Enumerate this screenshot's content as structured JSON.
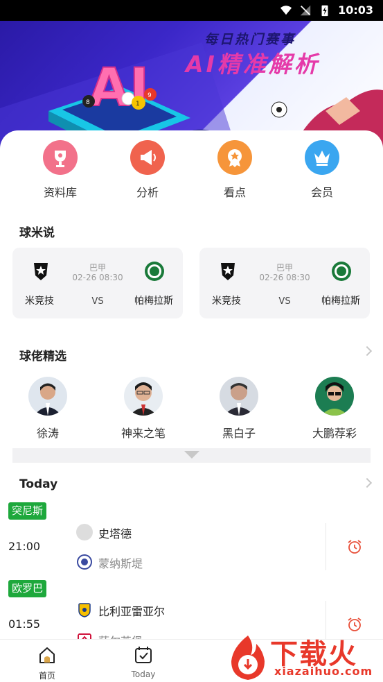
{
  "status_bar": {
    "time": "10:03"
  },
  "banner": {
    "line1": "每日热门赛事",
    "line2": "AI精准解析",
    "logo_text": "AI"
  },
  "quick_menu": [
    {
      "label": "资料库",
      "icon": "trophy-icon",
      "color": "#f2718a"
    },
    {
      "label": "分析",
      "icon": "megaphone-icon",
      "color": "#f0634e"
    },
    {
      "label": "看点",
      "icon": "medal-icon",
      "color": "#f6953a"
    },
    {
      "label": "会员",
      "icon": "crown-icon",
      "color": "#3aa6f0"
    }
  ],
  "section_qiumi": {
    "title": "球米说"
  },
  "match_cards": [
    {
      "home": "米竞技",
      "away": "帕梅拉斯",
      "league": "巴甲",
      "datetime": "02-26 08:30",
      "vs": "VS"
    },
    {
      "home": "米竞技",
      "away": "帕梅拉斯",
      "league": "巴甲",
      "datetime": "02-26 08:30",
      "vs": "VS"
    }
  ],
  "section_experts": {
    "title": "球佬精选"
  },
  "experts": [
    {
      "name": "徐涛"
    },
    {
      "name": "神来之笔"
    },
    {
      "name": "黑白子"
    },
    {
      "name": "大鹏荐彩"
    }
  ],
  "section_today": {
    "title": "Today"
  },
  "today_matches": [
    {
      "league": "突尼斯",
      "time": "21:00",
      "home": "史塔德",
      "away": "蒙纳斯堤"
    },
    {
      "league": "欧罗巴",
      "time": "01:55",
      "home": "比利亚雷亚尔",
      "away": "萨尔茨堡"
    }
  ],
  "tabbar": [
    {
      "label": "首页",
      "icon": "home-icon"
    },
    {
      "label": "Today",
      "icon": "calendar-check-icon"
    }
  ],
  "watermark": {
    "brand": "下载火",
    "domain": "xiazaihuo.com"
  },
  "colors": {
    "accent_green": "#1ea83c",
    "alarm_red": "#e8382a",
    "banner_blue": "#3b27c8"
  }
}
